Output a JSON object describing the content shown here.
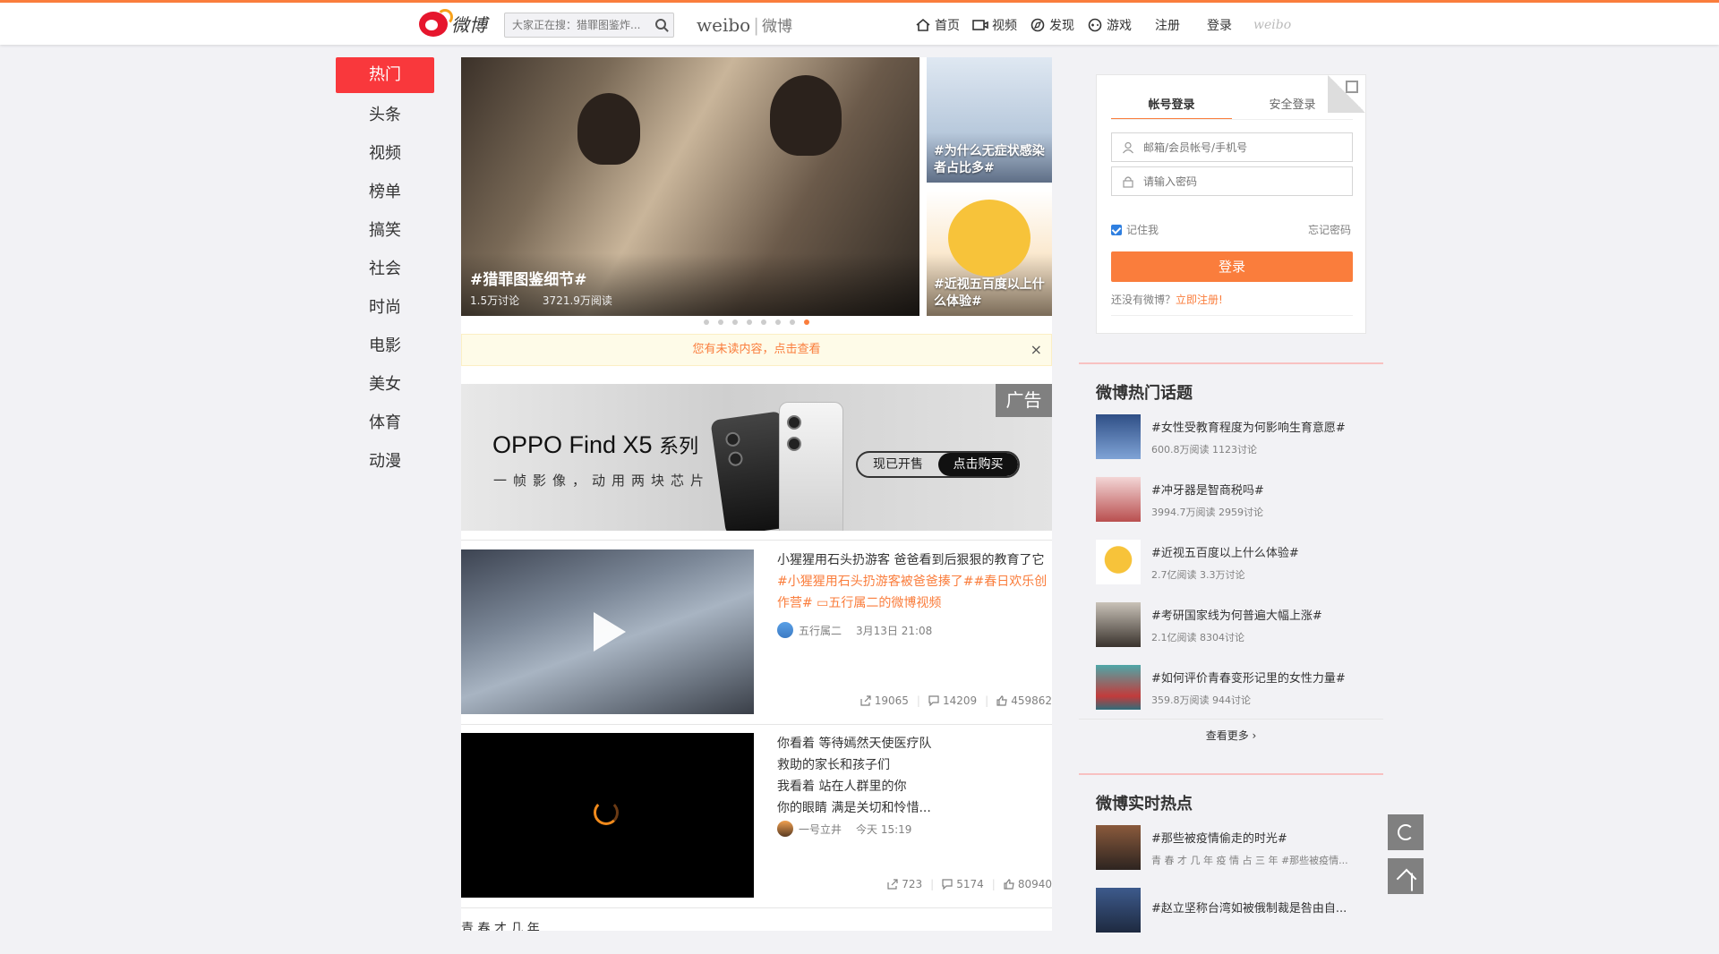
{
  "header": {
    "logo_text": "微博",
    "search_placeholder": "大家正在搜：猎罪图鉴炸...",
    "brand_en": "weibo",
    "brand_cn": "微博",
    "nav": [
      {
        "label": "首页",
        "icon": "home-icon"
      },
      {
        "label": "视频",
        "icon": "video-icon"
      },
      {
        "label": "发现",
        "icon": "compass-icon"
      },
      {
        "label": "游戏",
        "icon": "gamepad-icon"
      }
    ],
    "register": "注册",
    "login": "登录",
    "weibo_mini": "weibo"
  },
  "sidebar": {
    "items": [
      "热门",
      "头条",
      "视频",
      "榜单",
      "搞笑",
      "社会",
      "时尚",
      "电影",
      "美女",
      "体育",
      "动漫"
    ],
    "active": "热门"
  },
  "carousel": {
    "main": {
      "title": "#猎罪图鉴细节#",
      "discuss": "1.5万讨论",
      "reads": "3721.9万阅读"
    },
    "side": [
      {
        "title": "#为什么无症状感染者占比多#"
      },
      {
        "title": "#近视五百度以上什么体验#"
      }
    ],
    "dot_count": 8,
    "active_dot": 8
  },
  "notice": {
    "text": "您有未读内容，点击查看",
    "close": "×"
  },
  "ad": {
    "tag": "广告",
    "title_en": "OPPO Find X5",
    "title_cn": "系列",
    "subtitle": "一帧影像，动用两块芯片",
    "btn_left": "现已开售",
    "btn_right": "点击购买"
  },
  "feed": [
    {
      "text": "小猩猩用石头扔游客 爸爸看到后狠狠的教育了它",
      "tags": "#小猩猩用石头扔游客被爸爸揍了##春日欢乐创作营# ▭五行属二的微博视频",
      "author": "五行属二",
      "time": "3月13日 21:08",
      "shares": "19065",
      "comments": "14209",
      "likes": "459862"
    },
    {
      "lines": [
        "你看着 等待嫣然天使医疗队",
        "救助的家长和孩子们",
        "我看着 站在人群里的你",
        "你的眼睛 满是关切和怜惜..."
      ],
      "author": "一号立井",
      "time": "今天 15:19",
      "shares": "723",
      "comments": "5174",
      "likes": "80940"
    }
  ],
  "feed_bottom_text": "青 春 才 几 年",
  "login": {
    "tab_account": "帐号登录",
    "tab_secure": "安全登录",
    "username_placeholder": "邮箱/会员帐号/手机号",
    "password_placeholder": "请输入密码",
    "remember": "记住我",
    "forgot": "忘记密码",
    "button": "登录",
    "no_account": "还没有微博？",
    "register_now": "立即注册!"
  },
  "hot_topics": {
    "title": "微博热门话题",
    "items": [
      {
        "name": "#女性受教育程度为何影响生育意愿#",
        "meta": "600.8万阅读 1123讨论"
      },
      {
        "name": "#冲牙器是智商税吗#",
        "meta": "3994.7万阅读 2959讨论"
      },
      {
        "name": "#近视五百度以上什么体验#",
        "meta": "2.7亿阅读 3.3万讨论"
      },
      {
        "name": "#考研国家线为何普遍大幅上涨#",
        "meta": "2.1亿阅读 8304讨论"
      },
      {
        "name": "#如何评价青春变形记里的女性力量#",
        "meta": "359.8万阅读 944讨论"
      }
    ],
    "more": "查看更多 ›"
  },
  "realtime": {
    "title": "微博实时热点",
    "items": [
      {
        "name": "#那些被疫情偷走的时光#",
        "meta": "青 春 才 几 年 疫 情 占 三 年 #那些被疫情..."
      },
      {
        "name": "#赵立坚称台湾如被俄制裁是咎由自...",
        "meta": ""
      }
    ]
  },
  "colors": {
    "accent": "#fa7d3c",
    "active_nav": "#f9383c",
    "link": "#fa7d3c"
  }
}
